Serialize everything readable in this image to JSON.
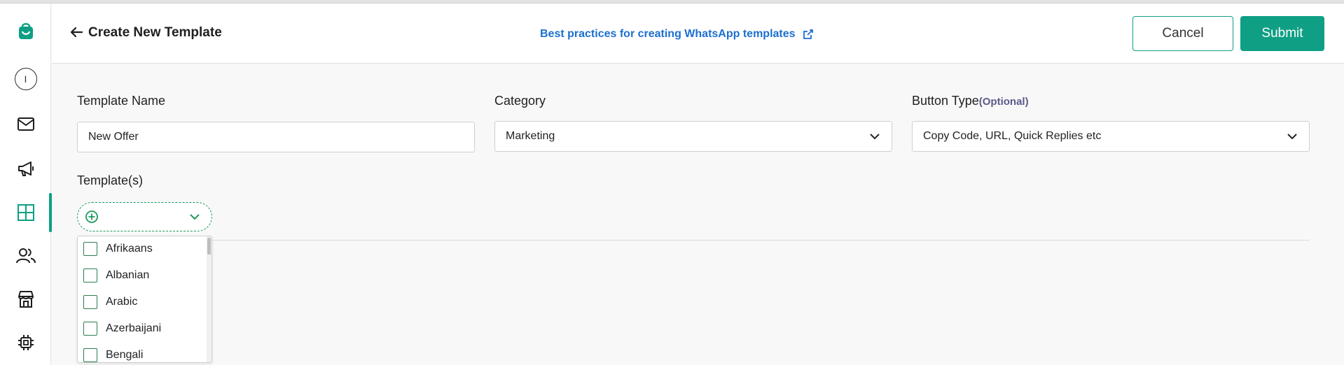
{
  "header": {
    "title": "Create New Template",
    "best_practices_link": "Best practices for creating WhatsApp templates",
    "cancel_label": "Cancel",
    "submit_label": "Submit"
  },
  "sidebar": {
    "items": [
      {
        "name": "brand-logo",
        "icon": "bag-icon"
      },
      {
        "name": "profile",
        "icon": "avatar-icon",
        "label": "I"
      },
      {
        "name": "inbox",
        "icon": "mail-icon"
      },
      {
        "name": "campaigns",
        "icon": "megaphone-icon"
      },
      {
        "name": "templates",
        "icon": "grid-icon",
        "active": true
      },
      {
        "name": "contacts",
        "icon": "users-icon"
      },
      {
        "name": "store",
        "icon": "storefront-icon"
      },
      {
        "name": "integrations",
        "icon": "chip-icon"
      }
    ]
  },
  "form": {
    "template_name": {
      "label": "Template Name",
      "value": "New Offer"
    },
    "category": {
      "label": "Category",
      "value": "Marketing"
    },
    "button_type": {
      "label": "Button Type",
      "optional": "(Optional)",
      "value": "Copy Code, URL, Quick Replies etc"
    },
    "templates": {
      "label": "Template(s)"
    }
  },
  "languages": [
    "Afrikaans",
    "Albanian",
    "Arabic",
    "Azerbaijani",
    "Bengali"
  ],
  "colors": {
    "accent": "#0e9f84",
    "link": "#1c6fd1",
    "checkbox": "#2e7d4f"
  }
}
